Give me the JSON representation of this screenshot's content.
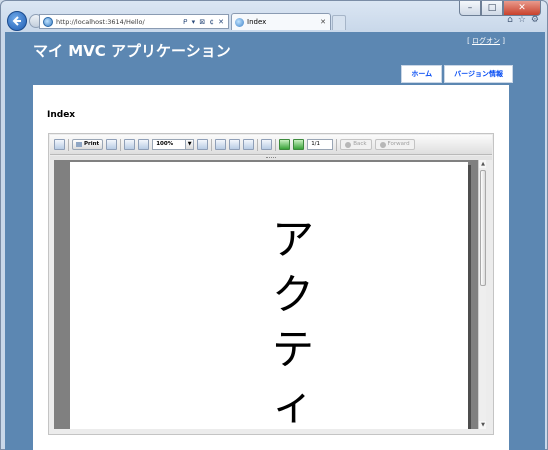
{
  "browser": {
    "url": "http://localhost:3614/Hello/",
    "address_actions": "ᑭ ▾ ⊠ ¢ ✕",
    "tab_title": "Index",
    "tab_close": "✕",
    "window_controls": {
      "minimize": "–",
      "maximize": "□",
      "close": "✕"
    },
    "toolbar_icons": [
      "home-icon",
      "star-icon",
      "gear-icon"
    ]
  },
  "site": {
    "title": "マイ MVC アプリケーション",
    "login": {
      "open": "[",
      "link": "ログオン",
      "close": "]"
    },
    "menu": [
      {
        "label": "ホーム"
      },
      {
        "label": "バージョン情報"
      }
    ]
  },
  "page": {
    "heading": "Index"
  },
  "report_viewer": {
    "print_label": "Print",
    "zoom_value": "100%",
    "zoom_dropdown": "▼",
    "page_value": "1/1",
    "back_label": "Back",
    "forward_label": "Forward",
    "content_text": "アクティ",
    "scroll_up": "▲",
    "scroll_down": "▼"
  },
  "colors": {
    "page_bg": "#5c87b2",
    "menu_text": "#034af3",
    "report_canvas": "#808080"
  }
}
